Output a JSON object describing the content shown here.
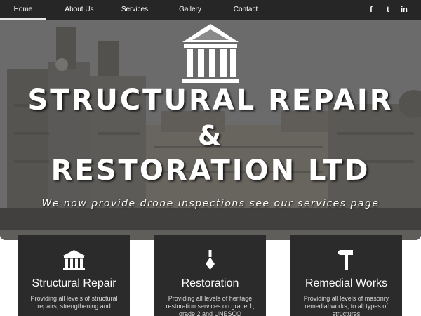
{
  "nav": {
    "items": [
      {
        "label": "Home",
        "active": true
      },
      {
        "label": "About Us"
      },
      {
        "label": "Services"
      },
      {
        "label": "Gallery"
      },
      {
        "label": "Contact"
      }
    ],
    "social": [
      {
        "icon": "facebook-icon",
        "glyph": "f"
      },
      {
        "icon": "twitter-icon",
        "glyph": "t"
      },
      {
        "icon": "linkedin-icon",
        "glyph": "in"
      }
    ]
  },
  "hero": {
    "line1": "STRUCTURAL REPAIR",
    "line2": "&",
    "line3": "RESTORATION LTD",
    "tagline": "We now provide drone inspections see our services page"
  },
  "cards": [
    {
      "icon": "columns-icon",
      "title": "Structural Repair",
      "text": "Providing all levels of structural repairs, strengthening and"
    },
    {
      "icon": "trowel-icon",
      "title": "Restoration",
      "text": "Providing all levels of heritage restoration services on grade 1, grade 2 and UNESCO"
    },
    {
      "icon": "hammer-icon",
      "title": "Remedial Works",
      "text": "Providing all levels of masonry remedial works, to all types of structures"
    }
  ],
  "colors": {
    "nav_bg": "#262626",
    "card_bg": "#2b2b2b",
    "text": "#ffffff"
  }
}
